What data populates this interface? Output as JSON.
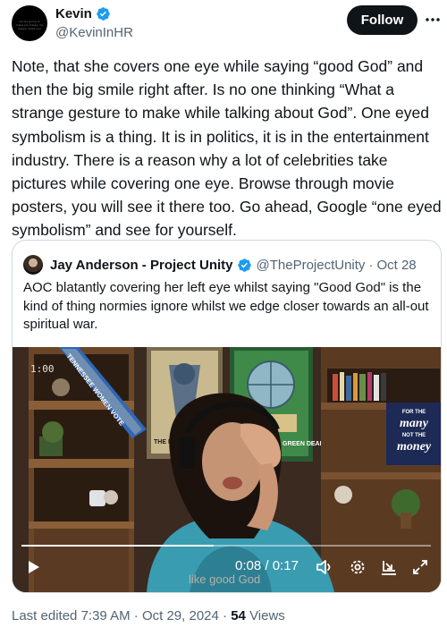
{
  "author": {
    "name": "Kevin",
    "handle": "@KevinInHR",
    "avatar_caption": "we are going to make you happy, be happy, make you"
  },
  "actions": {
    "follow_label": "Follow"
  },
  "tweet": {
    "text": "Note, that she covers one eye while saying “good God” and then the big smile right after. Is no one thinking “What a strange gesture to make while talking about God”. One eyed symbolism is a thing. It is in politics, it is in the entertainment industry. There is a reason why a lot of celebrities take pictures while covering one eye. Browse through movie posters, you will see it there too.  Go ahead, Google “one eyed symbolism” and see for yourself."
  },
  "quoted": {
    "name": "Jay Anderson - Project Unity",
    "handle": "@TheProjectUnity",
    "separator": "·",
    "date": "Oct 28",
    "text": "AOC blatantly covering her left eye whilst saying \"Good God\" is the kind of thing normies ignore whilst we edge closer towards an all-out spiritual war.",
    "video": {
      "corner_time": "1:00",
      "caption": "like good God",
      "current_time": "0:08",
      "duration": "0:17",
      "time_separator": " / ",
      "progress": 0.47,
      "sash_text": "TENNESSEE WOMEN VOTE",
      "poster_left_text": "THE NEW",
      "poster_right_text": "GREEN DEAL",
      "sign_text_top": "FOR THE",
      "sign_text_mid": "many",
      "sign_text_low": "NOT THE",
      "sign_text_bottom": "money"
    }
  },
  "meta": {
    "edited_prefix": "Last edited",
    "time": "7:39 AM",
    "separator": "·",
    "date": "Oct 29, 2024",
    "views_count": "54",
    "views_label": "Views"
  },
  "colors": {
    "verified": "#1d9bf0",
    "secondary_text": "#536471",
    "border": "#cfd9de"
  }
}
